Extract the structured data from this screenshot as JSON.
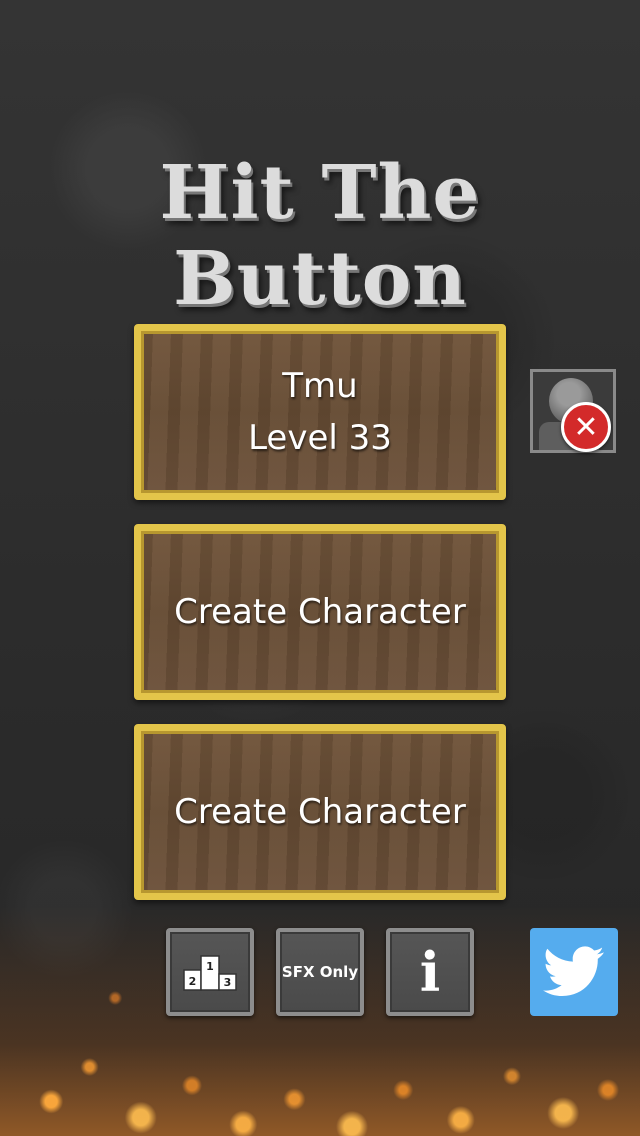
{
  "title": "Hit The Button",
  "slots": [
    {
      "line1": "Tmu",
      "line2": "Level 33"
    },
    {
      "line1": "Create Character"
    },
    {
      "line1": "Create Character"
    }
  ],
  "bottom_bar": {
    "leaderboard_icon": "podium-icon",
    "podium_labels": [
      "2",
      "1",
      "3"
    ],
    "sfx_label": "SFX Only",
    "info_glyph": "i",
    "twitter_icon": "twitter-bird-icon"
  },
  "colors": {
    "slot_border": "#e3c54a",
    "delete": "#d32a2a",
    "twitter": "#55acee"
  }
}
